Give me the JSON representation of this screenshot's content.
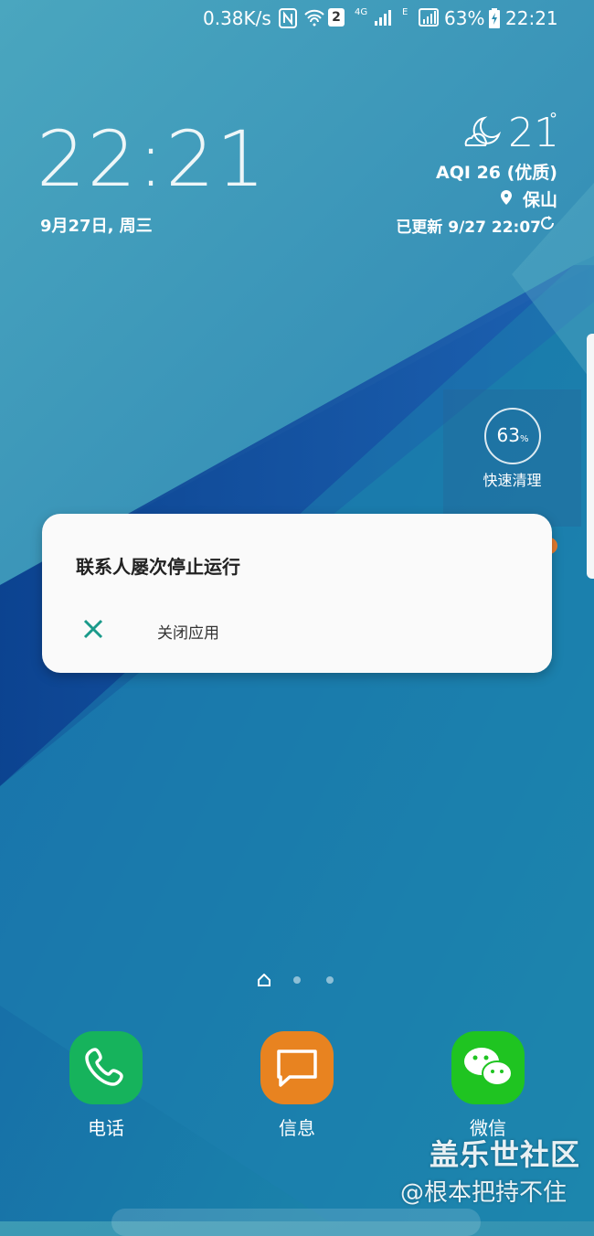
{
  "status_bar": {
    "net_speed": "0.38K/s",
    "sim_badge": "2",
    "net_4g": "4G",
    "net_e": "E",
    "battery_percent": "63%",
    "time": "22:21"
  },
  "clock_widget": {
    "time": "22:21",
    "date": "9月27日, 周三"
  },
  "weather_widget": {
    "icon": "moon-cloud-icon",
    "temperature": "21",
    "degree": "°",
    "aqi": "AQI 26 (优质)",
    "location": "保山",
    "updated": "已更新 9/27 22:07"
  },
  "quick_clean": {
    "percent": "63",
    "unit": "%",
    "label": "快速清理"
  },
  "dialog": {
    "title": "联系人屡次停止运行",
    "close_label": "关闭应用",
    "accent": "#1a9a8a"
  },
  "dock": [
    {
      "label": "电话",
      "icon": "phone-icon",
      "color": "#16b35c"
    },
    {
      "label": "信息",
      "icon": "message-icon",
      "color": "#e88320"
    },
    {
      "label": "微信",
      "icon": "wechat-icon",
      "color": "#1fc421"
    }
  ],
  "watermark": {
    "line1": "盖乐世社区",
    "line2": "@根本把持不住"
  }
}
